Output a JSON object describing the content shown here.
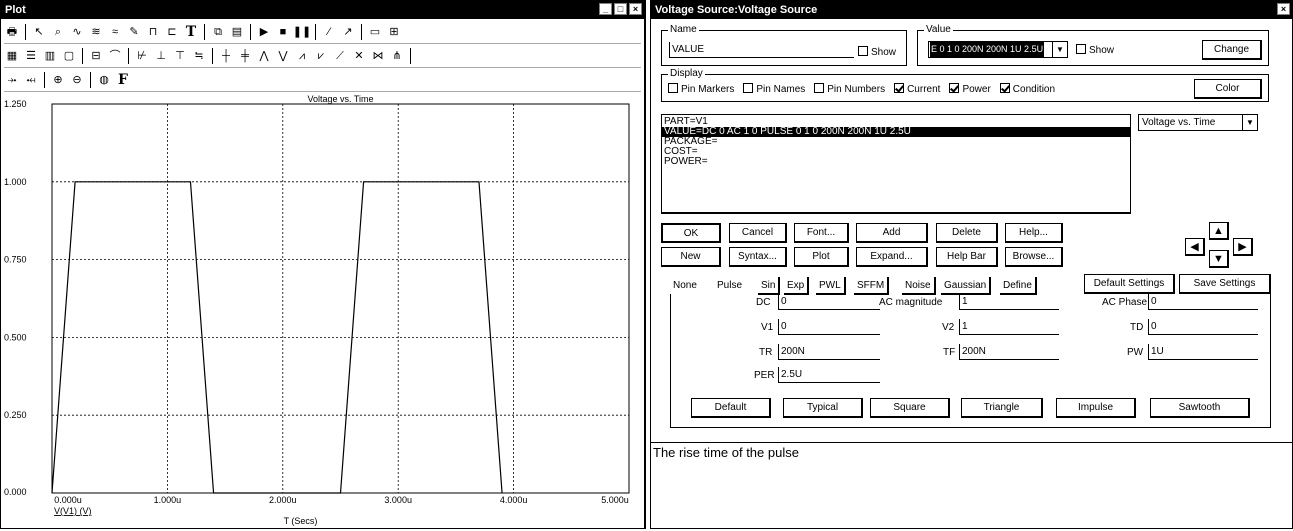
{
  "plot_window": {
    "title": "Plot",
    "caption_buttons": [
      "_",
      "□",
      "×"
    ],
    "toolbar_rows": [
      [
        "printer-icon",
        "|",
        "arrow-select-icon",
        "zoom-select-icon",
        "curve-tool-icon",
        "waveform-icon",
        "wave-alt-icon",
        "annotate-icon",
        "component-icon",
        "connector-icon",
        "T",
        "|",
        "copy-plot-icon",
        "table-icon",
        "|",
        "▶",
        "■",
        "❚❚",
        "|",
        "slope-line-icon",
        "measure-line-icon",
        "|",
        "frame-icon",
        "grid-icon"
      ],
      [
        "grid-solid-icon",
        "grid-lines-icon",
        "grid-dots-icon",
        "grid-none-icon",
        "|",
        "hline-icon",
        "curve-icon",
        "|",
        "cursor-a-icon",
        "cursor-b-icon",
        "cursor-c-icon",
        "cursor-d-icon",
        "|",
        "marker-1-icon",
        "marker-2-icon",
        "peak-icon",
        "valley-icon",
        "rise-icon",
        "fall-icon",
        "slope-icon",
        "cross-icon",
        "inflection-icon",
        "multi-icon",
        "|"
      ],
      [
        "axis-x-icon",
        "axis-y-icon",
        "|",
        "zoom-in-icon",
        "zoom-out-icon",
        "|",
        "globe-icon",
        "F"
      ]
    ]
  },
  "chart_data": {
    "type": "line",
    "title": "Voltage vs. Time",
    "xlabel": "T (Secs)",
    "ylabel": "",
    "xlim": [
      0,
      5
    ],
    "ylim": [
      0,
      1.25
    ],
    "x_unit_suffix": "u",
    "x_ticks": [
      "0.000u",
      "1.000u",
      "2.000u",
      "3.000u",
      "4.000u",
      "5.000u"
    ],
    "y_ticks": [
      "0.000",
      "0.250",
      "0.500",
      "0.750",
      "1.000",
      "1.250"
    ],
    "grid": true,
    "series": [
      {
        "name": "V(V1) (V)",
        "color": "#000000",
        "x": [
          0,
          0.2,
          1.2,
          1.4,
          2.5,
          2.7,
          3.7,
          3.9
        ],
        "y": [
          0,
          1,
          1,
          0,
          0,
          1,
          1,
          0
        ]
      }
    ]
  },
  "dialog": {
    "title": "Voltage Source:Voltage Source",
    "close_glyph": "×",
    "name_group": {
      "label": "Name",
      "value": "VALUE",
      "show_label": "Show",
      "show_checked": false
    },
    "value_group": {
      "label": "Value",
      "value": "E 0 1 0 200N 200N 1U 2.5U",
      "show_label": "Show",
      "show_checked": false,
      "change_label": "Change"
    },
    "display_group": {
      "label": "Display",
      "items": [
        {
          "label": "Pin Markers",
          "checked": false
        },
        {
          "label": "Pin Names",
          "checked": false
        },
        {
          "label": "Pin Numbers",
          "checked": false
        },
        {
          "label": "Current",
          "checked": true
        },
        {
          "label": "Power",
          "checked": true
        },
        {
          "label": "Condition",
          "checked": true
        }
      ],
      "color_label": "Color"
    },
    "attributes": [
      "PART=V1",
      "VALUE=DC 0 AC 1 0 PULSE 0 1 0 200N 200N 1U 2.5U",
      "PACKAGE=",
      "COST=",
      "POWER="
    ],
    "selected_attribute_index": 1,
    "plot_select": "Voltage vs. Time",
    "buttons_row1": [
      "OK",
      "Cancel",
      "Font...",
      "Add",
      "Delete",
      "Help..."
    ],
    "buttons_row2": [
      "New",
      "Syntax...",
      "Plot",
      "Expand...",
      "Help Bar",
      "Browse..."
    ],
    "tabs": [
      "None",
      "Pulse",
      "Sin",
      "Exp",
      "PWL",
      "SFFM",
      "Noise",
      "Gaussian",
      "Define"
    ],
    "selected_tab": "Pulse",
    "default_settings_label": "Default Settings",
    "save_settings_label": "Save Settings",
    "params": {
      "dc": {
        "label": "DC",
        "value": "0"
      },
      "ac_mag": {
        "label": "AC magnitude",
        "value": "1"
      },
      "ac_phase": {
        "label": "AC Phase",
        "value": "0"
      },
      "v1": {
        "label": "V1",
        "value": "0"
      },
      "v2": {
        "label": "V2",
        "value": "1"
      },
      "td": {
        "label": "TD",
        "value": "0"
      },
      "tr": {
        "label": "TR",
        "value": "200N"
      },
      "tf": {
        "label": "TF",
        "value": "200N"
      },
      "pw": {
        "label": "PW",
        "value": "1U"
      },
      "per": {
        "label": "PER",
        "value": "2.5U"
      }
    },
    "preset_buttons": [
      "Default",
      "Typical",
      "Square",
      "Triangle",
      "Impulse",
      "Sawtooth"
    ],
    "help_text": "The rise time of the pulse"
  }
}
